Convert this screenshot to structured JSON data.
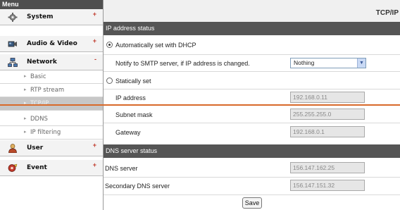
{
  "sidebar": {
    "header": "Menu",
    "categories": {
      "system": {
        "label": "System",
        "marker": "+"
      },
      "audio_video": {
        "label": "Audio & Video",
        "marker": "+"
      },
      "network": {
        "label": "Network",
        "marker": "-"
      },
      "user": {
        "label": "User",
        "marker": "+"
      },
      "event": {
        "label": "Event",
        "marker": "+"
      }
    },
    "network_items": {
      "basic": "Basic",
      "rtp_stream": "RTP stream",
      "tcpip": "TCP/IP",
      "ddns": "DDNS",
      "ip_filtering": "IP filtering"
    },
    "sub_arrow": "▸"
  },
  "main": {
    "title": "TCP/IP",
    "ip_section": {
      "header": "IP address status",
      "dhcp_option": "Automatically set with DHCP",
      "notify_label": "Notify to SMTP server, if IP address is changed.",
      "notify_value": "Nothing",
      "static_option": "Statically set",
      "selected_mode": "dhcp",
      "ip_address_label": "IP address",
      "ip_address_value": "192.168.0.11",
      "subnet_label": "Subnet mask",
      "subnet_value": "255.255.255.0",
      "gateway_label": "Gateway",
      "gateway_value": "192.168.0.1"
    },
    "dns_section": {
      "header": "DNS server status",
      "dns_label": "DNS server",
      "dns_value": "156.147.162.25",
      "secondary_label": "Secondary DNS server",
      "secondary_value": "156.147.151.32"
    },
    "save_label": "Save"
  },
  "colors": {
    "section_header_bg": "#555555",
    "menu_header_bg": "#4f4f4f",
    "overlay_line": "#d86a2a",
    "marker": "#c0392b"
  }
}
